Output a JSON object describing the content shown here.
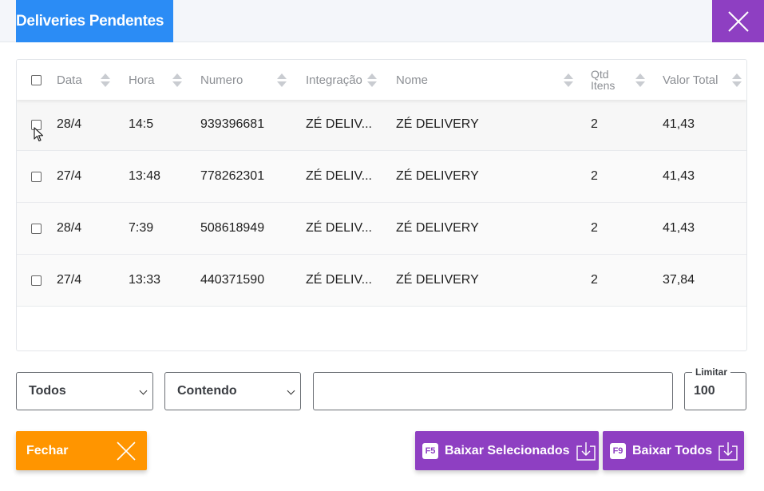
{
  "window": {
    "title": "Deliveries Pendentes"
  },
  "table": {
    "columns": [
      {
        "label": "Data"
      },
      {
        "label": "Hora"
      },
      {
        "label": "Numero"
      },
      {
        "label": "Integração"
      },
      {
        "label": "Nome"
      },
      {
        "label_line1": "Qtd",
        "label_line2": "Itens"
      },
      {
        "label": "Valor Total"
      }
    ],
    "rows": [
      {
        "data": "28/4",
        "hora": "14:5",
        "numero": "939396681",
        "integracao": "ZÉ DELIV...",
        "nome": "ZÉ DELIVERY",
        "qtd": "2",
        "valor": "41,43"
      },
      {
        "data": "27/4",
        "hora": "13:48",
        "numero": "778262301",
        "integracao": "ZÉ DELIV...",
        "nome": "ZÉ DELIVERY",
        "qtd": "2",
        "valor": "41,43"
      },
      {
        "data": "28/4",
        "hora": "7:39",
        "numero": "508618949",
        "integracao": "ZÉ DELIV...",
        "nome": "ZÉ DELIVERY",
        "qtd": "2",
        "valor": "41,43"
      },
      {
        "data": "27/4",
        "hora": "13:33",
        "numero": "440371590",
        "integracao": "ZÉ DELIV...",
        "nome": "ZÉ DELIVERY",
        "qtd": "2",
        "valor": "37,84"
      }
    ]
  },
  "filters": {
    "scope_value": "Todos",
    "mode_value": "Contendo",
    "search_value": "",
    "limit_label": "Limitar",
    "limit_value": "100"
  },
  "buttons": {
    "close_label": "Fechar",
    "download_selected_key": "F5",
    "download_selected_label": "Baixar Selecionados",
    "download_all_key": "F9",
    "download_all_label": "Baixar Todos"
  },
  "colors": {
    "title_bg": "#2b8cf5",
    "close_bg": "#8e3fc2",
    "fechar_bg": "#ff9500",
    "action_bg": "#8e3fc2"
  },
  "icons": {
    "close": "close-icon",
    "sort": "sort-icon",
    "dropdown": "chevron-down-icon",
    "download": "download-icon",
    "cursor": "mouse-cursor-icon"
  }
}
